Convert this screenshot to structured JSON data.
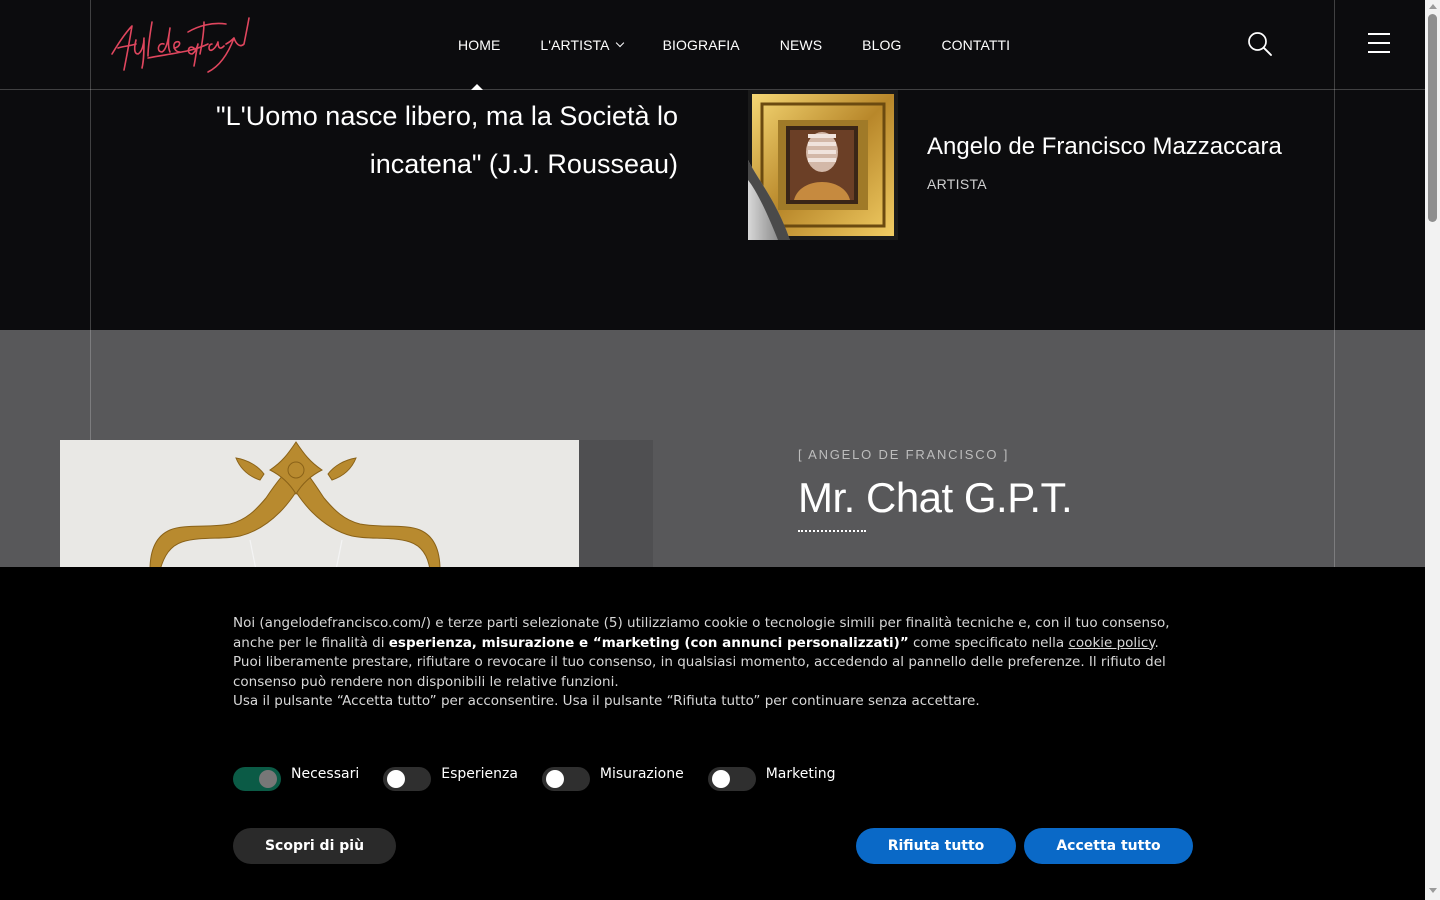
{
  "header": {
    "logo_alt": "Angelo de Francisco signature",
    "nav": [
      {
        "label": "HOME"
      },
      {
        "label": "L'ARTISTA"
      },
      {
        "label": "BIOGRAFIA"
      },
      {
        "label": "NEWS"
      },
      {
        "label": "BLOG"
      },
      {
        "label": "CONTATTI"
      }
    ],
    "active_item": "HOME"
  },
  "hero": {
    "quote": "\"L'Uomo nasce libero, ma la Società lo incatena\" (J.J. Rousseau)",
    "artist_name": "Angelo de Francisco Mazzaccara",
    "artist_role": "ARTISTA"
  },
  "post": {
    "kicker": "[ ANGELO DE FRANCISCO ]",
    "title": "Mr. Chat G.P.T."
  },
  "cookie": {
    "p1_a": "Noi (angelodefrancisco.com/) e terze parti selezionate (5) utilizziamo cookie o tecnologie simili per finalità tecniche e, con il tuo consenso, anche per le finalità di ",
    "p1_bold": "esperienza, misurazione e “marketing (con annunci personalizzati)”",
    "p1_b": " come specificato nella ",
    "policy_link": "cookie policy",
    "p1_end": ".",
    "p2": "Puoi liberamente prestare, rifiutare o revocare il tuo consenso, in qualsiasi momento, accedendo al pannello delle preferenze. Il rifiuto del consenso può rendere non disponibili le relative funzioni.",
    "p3": "Usa il pulsante “Accetta tutto” per acconsentire. Usa il pulsante “Rifiuta tutto” per continuare senza accettare.",
    "toggles": [
      {
        "label": "Necessari",
        "on": true
      },
      {
        "label": "Esperienza",
        "on": false
      },
      {
        "label": "Misurazione",
        "on": false
      },
      {
        "label": "Marketing",
        "on": false
      }
    ],
    "learn_more": "Scopri di più",
    "reject_all": "Rifiuta tutto",
    "accept_all": "Accetta tutto"
  },
  "colors": {
    "accent_button": "#0a69c7",
    "toggle_on": "#0b5b46",
    "logo_red": "#e0465e"
  }
}
